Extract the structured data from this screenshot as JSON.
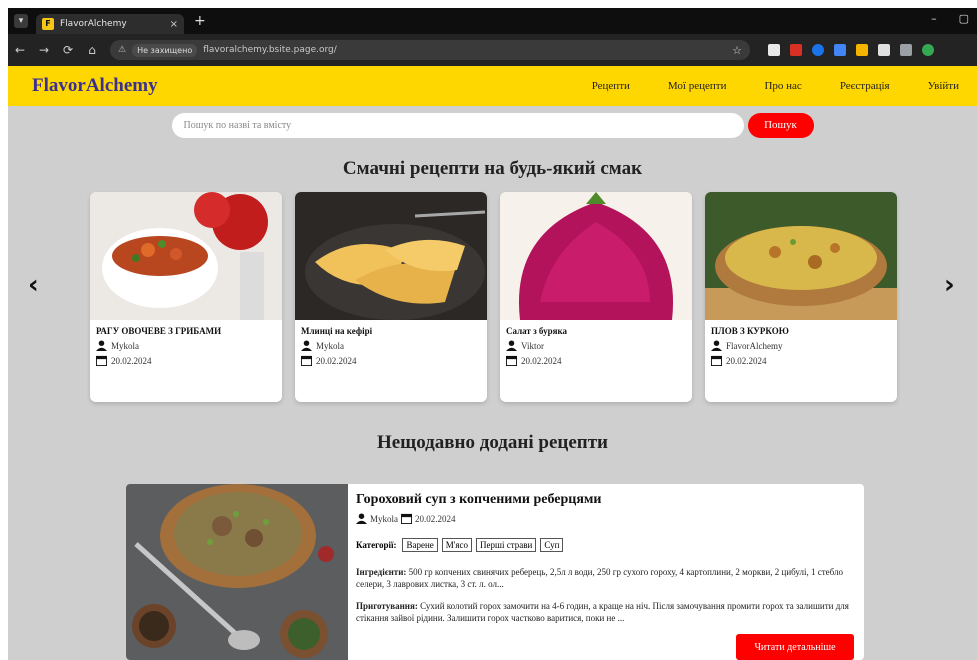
{
  "browser": {
    "tab_title": "FlavorAlchemy",
    "tab_close": "×",
    "new_tab": "+",
    "tab_menu": "▾",
    "omni_badge": "Не захищено",
    "url": "flavoralchemy.bsite.page.org/",
    "nav": {
      "back": "←",
      "forward": "→",
      "reload": "⟳",
      "home": "⌂"
    },
    "win": {
      "minimize": "–",
      "restore": "▢"
    },
    "star": "☆"
  },
  "site": {
    "logo": "FlavorAlchemy",
    "nav": [
      "Рецепти",
      "Мої рецепти",
      "Про нас",
      "Реєстрація",
      "Увійти"
    ],
    "search": {
      "placeholder": "Пошук по назві та вмісту",
      "button": "Пошук"
    },
    "section_popular": "Смачні рецепти на будь-який смак",
    "arrow_left": "‹",
    "arrow_right": "›",
    "cards": [
      {
        "title": "РАГУ ОВОЧЕВЕ З ГРИБАМИ",
        "author": "Mykola",
        "date": "20.02.2024"
      },
      {
        "title": "Млинці на кефірі",
        "author": "Mykola",
        "date": "20.02.2024"
      },
      {
        "title": "Салат з буряка",
        "author": "Viktor",
        "date": "20.02.2024"
      },
      {
        "title": "ПЛОВ З КУРКОЮ",
        "author": "FlavorAlchemy",
        "date": "20.02.2024"
      }
    ],
    "section_recent": "Нещодавно додані рецепти",
    "recent": {
      "title": "Гороховий суп з копченими реберцями",
      "author": "Mykola",
      "date": "20.02.2024",
      "categories_label": "Категорії:",
      "categories": [
        "Варене",
        "М'ясо",
        "Перші страви",
        "Суп"
      ],
      "ingredients_label": "Інгредієнти:",
      "ingredients": "500 гр копчених свинячих реберець, 2,5л л води, 250 гр сухого гороху, 4 картоплини, 2 моркви, 2 цибулі, 1 стебло селери, 3 лаврових листка, 3 ст. л. ол...",
      "prep_label": "Приготування:",
      "prep": "Сухий колотий горох замочити на 4-6 годин, а краще на ніч. Після замочування промити горох та залишити для стікання зайвої рідини. Залишити горох частково варитися, поки не ...",
      "read_more": "Читати детальніше"
    }
  }
}
